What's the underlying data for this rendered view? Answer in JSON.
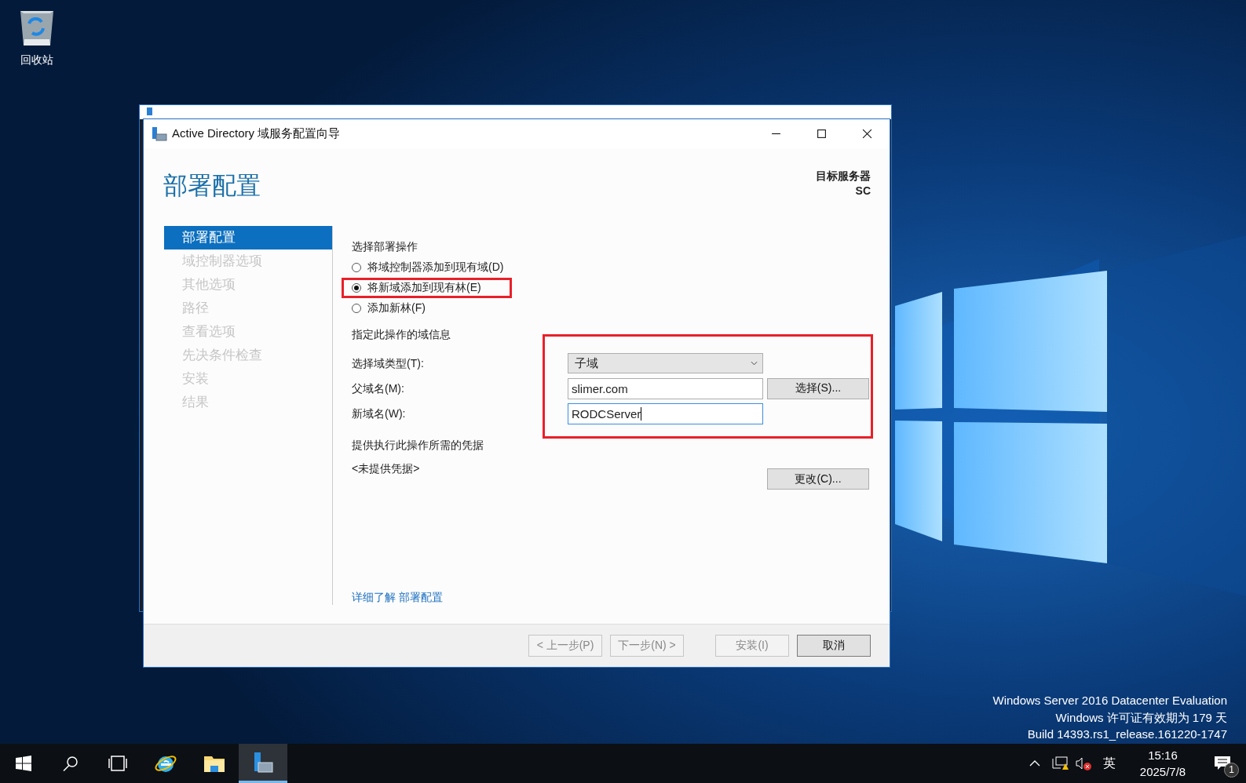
{
  "desktop": {
    "icons": [
      {
        "label": "回收站"
      }
    ]
  },
  "window": {
    "title": "Active Directory 域服务配置向导",
    "heading": "部署配置",
    "target_label": "目标服务器",
    "target_value": "SC",
    "steps": [
      {
        "label": "部署配置",
        "selected": true
      },
      {
        "label": "域控制器选项",
        "selected": false
      },
      {
        "label": "其他选项",
        "selected": false
      },
      {
        "label": "路径",
        "selected": false
      },
      {
        "label": "查看选项",
        "selected": false
      },
      {
        "label": "先决条件检查",
        "selected": false
      },
      {
        "label": "安装",
        "selected": false
      },
      {
        "label": "结果",
        "selected": false
      }
    ],
    "operations_title": "选择部署操作",
    "operations": [
      {
        "label": "将域控制器添加到现有域(D)",
        "selected": false
      },
      {
        "label": "将新域添加到现有林(E)",
        "selected": true
      },
      {
        "label": "添加新林(F)",
        "selected": false
      }
    ],
    "domain_title": "指定此操作的域信息",
    "fields": [
      {
        "kind": "dropdown",
        "label": "选择域类型(T):",
        "value": "子域"
      },
      {
        "kind": "text",
        "label": "父域名(M):",
        "value": "slimer.com",
        "focused": false,
        "button": "选择(S)..."
      },
      {
        "kind": "text",
        "label": "新域名(W):",
        "value": "RODCServer",
        "focused": true
      }
    ],
    "credentials_title": "提供执行此操作所需的凭据",
    "credentials_value": "<未提供凭据>",
    "change_button": "更改(C)...",
    "link": "详细了解 部署配置",
    "buttons": [
      {
        "label": "< 上一步(P)",
        "disabled": true
      },
      {
        "label": "下一步(N) >",
        "disabled": true
      },
      {
        "label": "安装(I)",
        "disabled": true
      },
      {
        "label": "取消",
        "disabled": false
      }
    ]
  },
  "edition_notice": [
    "Windows Server 2016 Datacenter Evaluation",
    "Windows 许可证有效期为 179 天",
    "Build 14393.rs1_release.161220-1747"
  ],
  "taskbar": {
    "apps": [
      {
        "kind": "browser",
        "active": false
      },
      {
        "kind": "folder",
        "active": false
      },
      {
        "kind": "server",
        "active": true
      }
    ],
    "input_indicator": "英",
    "time": "15:16",
    "date": "2025/7/8",
    "notification_count": "1"
  }
}
